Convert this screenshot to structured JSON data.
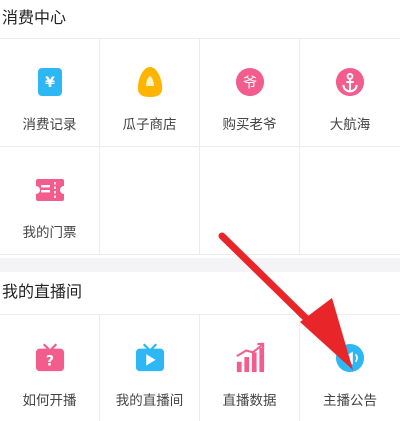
{
  "consume_section": {
    "title": "消费中心",
    "items": [
      {
        "label": "消费记录",
        "icon": "yuan-wallet-icon",
        "color": "#2db7f5"
      },
      {
        "label": "瓜子商店",
        "icon": "melon-seed-icon",
        "color": "#ffb400"
      },
      {
        "label": "购买老爷",
        "icon": "lord-badge-icon",
        "color": "#f25d8e"
      },
      {
        "label": "大航海",
        "icon": "anchor-icon",
        "color": "#f25d8e"
      },
      {
        "label": "我的门票",
        "icon": "ticket-icon",
        "color": "#f25d8e"
      }
    ]
  },
  "live_section": {
    "title": "我的直播间",
    "items": [
      {
        "label": "如何开播",
        "icon": "tv-question-icon",
        "color": "#f25d8e"
      },
      {
        "label": "我的直播间",
        "icon": "tv-play-icon",
        "color": "#2db7f5"
      },
      {
        "label": "直播数据",
        "icon": "bar-chart-icon",
        "color": "#f25d8e"
      },
      {
        "label": "主播公告",
        "icon": "announcement-icon",
        "color": "#2db7f5"
      }
    ]
  },
  "annotation": {
    "arrow_color": "#e8262a"
  }
}
